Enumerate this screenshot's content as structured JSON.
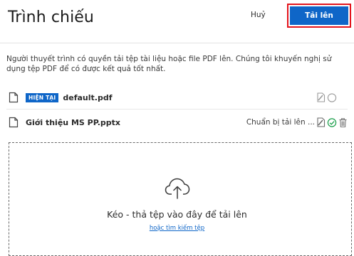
{
  "header": {
    "title": "Trình chiếu",
    "cancel_label": "Huỷ",
    "upload_label": "Tải lên"
  },
  "description": "Người thuyết trình có quyền tải tệp tài liệu hoặc file PDF lên. Chúng tôi khuyến nghị sử dụng tệp PDF để có được kết quả tốt nhất.",
  "files": [
    {
      "badge": "HIỆN TẠI",
      "name": "default.pdf",
      "status": ""
    },
    {
      "badge": "",
      "name": "Giới thiệu MS PP.pptx",
      "status": "Chuẩn bị tải lên ..."
    }
  ],
  "dropzone": {
    "text": "Kéo - thả tệp vào đây để tải lên",
    "link": "hoặc tìm kiếm tệp"
  },
  "colors": {
    "accent": "#0f66c8",
    "highlight_border": "#e3141c",
    "check": "#1a9e4a"
  },
  "icons": {
    "file": "file-icon",
    "download_toggle": "download-toggle-icon",
    "current_radio": "radio-icon",
    "ready_check": "check-circle-icon",
    "delete": "trash-icon",
    "upload": "cloud-upload-icon"
  }
}
